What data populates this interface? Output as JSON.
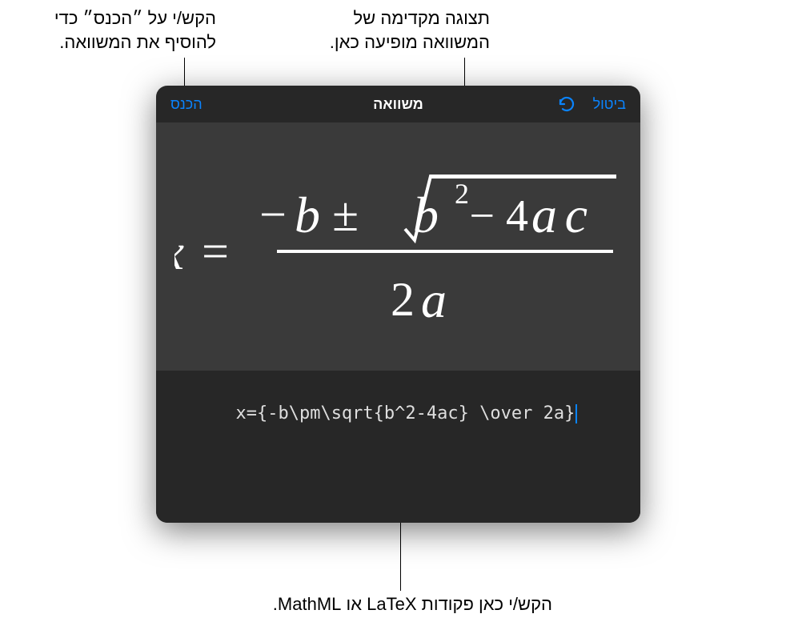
{
  "callouts": {
    "preview": "תצוגה מקדימה של המשוואה מופיעה כאן.",
    "insert": "הקש/י על ״הכנס״ כדי להוסיף את המשוואה.",
    "input": "הקש/י כאן פקודות LaTeX או MathML."
  },
  "dialog": {
    "title": "משוואה",
    "cancel_label": "ביטול",
    "insert_label": "הכנס",
    "undo_icon_name": "undo-icon"
  },
  "input": {
    "code": "x={-b\\pm\\sqrt{b^2-4ac} \\over 2a}"
  },
  "colors": {
    "accent": "#0a84ff",
    "dialog_bg": "#272727",
    "preview_bg": "#3a3a3a",
    "text_light": "#ffffff"
  }
}
